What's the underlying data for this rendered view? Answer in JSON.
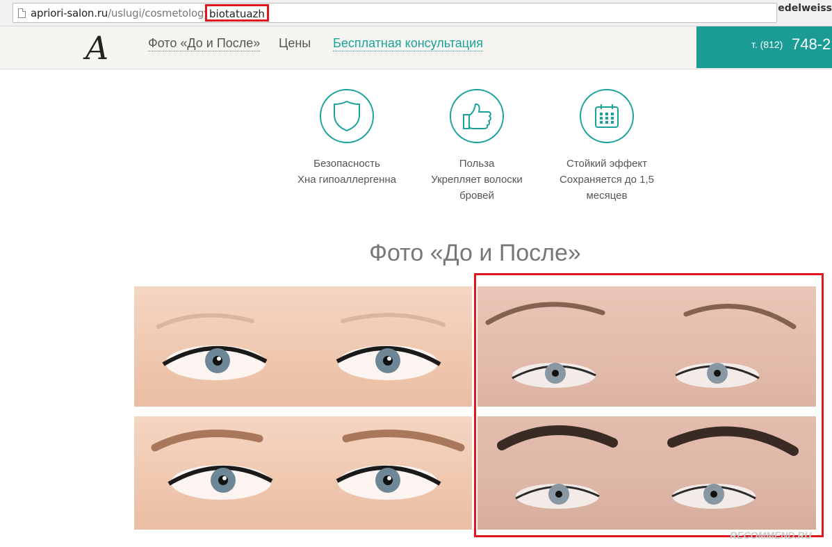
{
  "browser": {
    "url_domain": "apriori-salon.ru",
    "url_path": "/uslugi/cosmetology",
    "url_highlight": "biotatuazh",
    "profile_name": "edelweiss"
  },
  "header": {
    "logo": "A",
    "nav": [
      {
        "label": "Фото «До и После»"
      },
      {
        "label": "Цены"
      },
      {
        "label": "Бесплатная консультация"
      }
    ],
    "phone_prefix": "т. (812)",
    "phone_number": "748-2"
  },
  "features": [
    {
      "icon": "shield-icon",
      "title": "Безопасность",
      "desc": "Хна гипоаллергенна"
    },
    {
      "icon": "thumbs-up-icon",
      "title": "Польза",
      "desc": "Укрепляет волоски бровей"
    },
    {
      "icon": "calendar-icon",
      "title": "Стойкий эффект",
      "desc": "Сохраняется до 1,5 месяцев"
    }
  ],
  "gallery": {
    "title": "Фото «До и После»"
  },
  "watermark": "RECOMMEND.RU",
  "colors": {
    "accent": "#1aa39b",
    "highlight": "#e0161f"
  }
}
